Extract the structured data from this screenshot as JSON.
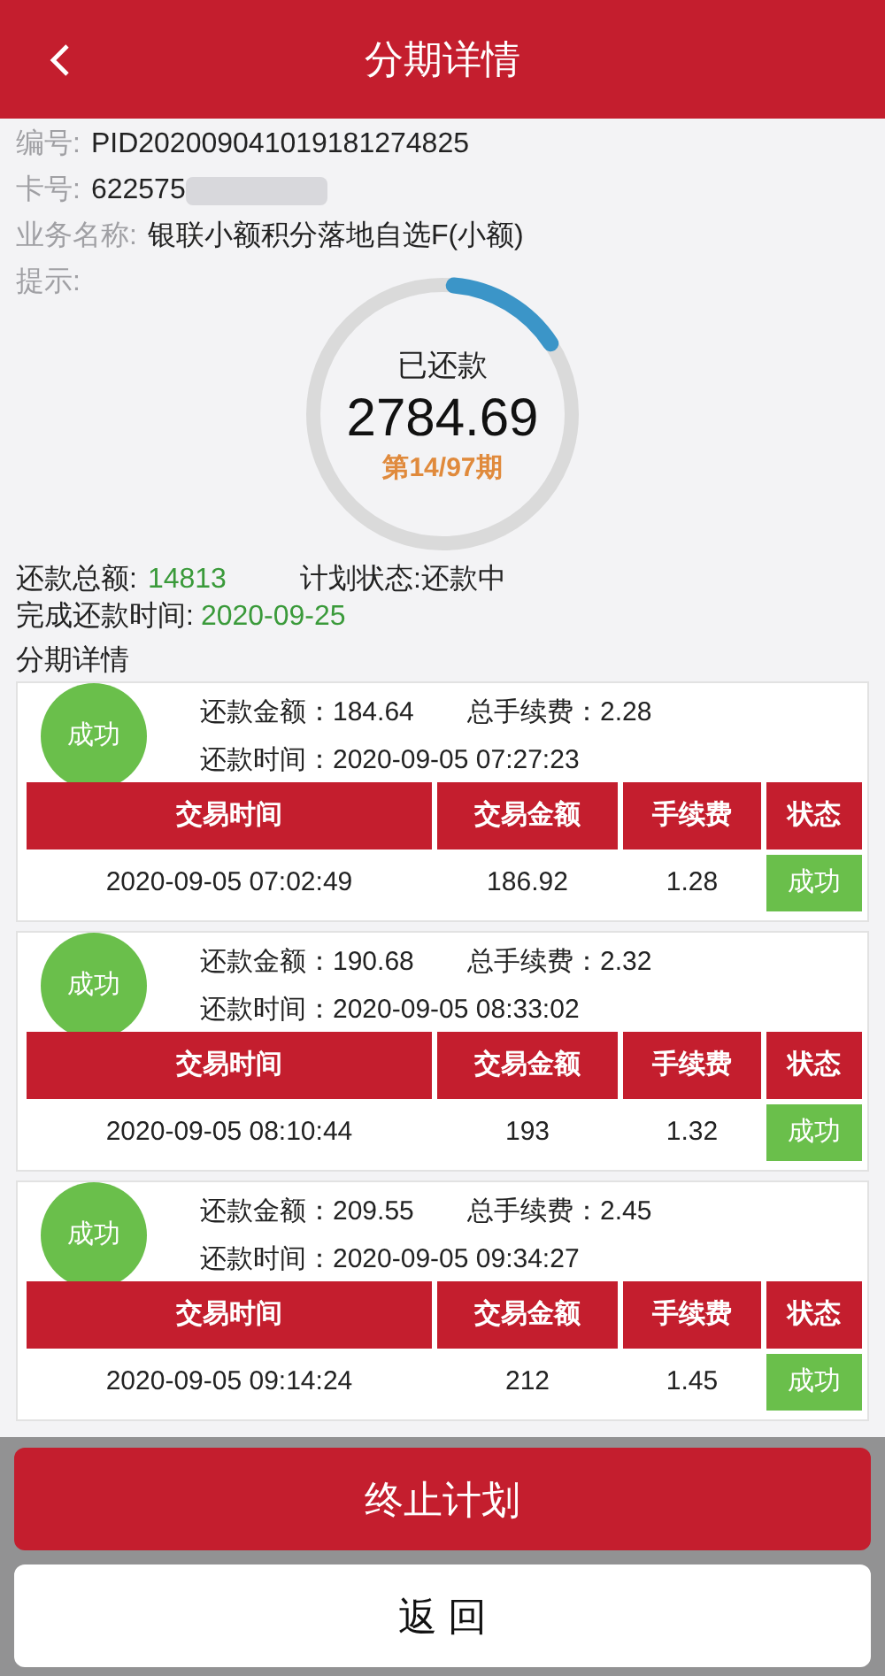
{
  "header": {
    "title": "分期详情"
  },
  "info": [
    {
      "label": "编号:",
      "value": "PID202009041019181274825"
    },
    {
      "label": "卡号:",
      "value": "622575",
      "redacted": true
    },
    {
      "label": "业务名称:",
      "value": "银联小额积分落地自选F(小额)"
    },
    {
      "label": "提示:"
    }
  ],
  "progress": {
    "caption": "已还款",
    "amount": "2784.69",
    "period": "第14/97期",
    "level": 0.144
  },
  "summary": {
    "total_label": "还款总额:",
    "total": "14813",
    "status": "计划状态:还款中",
    "finish_label": "完成还款时间:",
    "finish": "2020-09-25"
  },
  "section_title": "分期详情",
  "installments": [
    {
      "columns": [
        "交易时间",
        "交易金额",
        "手续费",
        "状态"
      ],
      "badge": "成功",
      "amount_label": "还款金额：",
      "amount": "184.64",
      "fee_label": "总手续费：",
      "fee": "2.28",
      "time_label": "还款时间：",
      "time": "2020-09-05 07:27:23",
      "row": [
        "2020-09-05 07:02:49",
        "186.92",
        "1.28",
        "成功"
      ]
    },
    {
      "columns": [
        "交易时间",
        "交易金额",
        "手续费",
        "状态"
      ],
      "badge": "成功",
      "amount_label": "还款金额：",
      "amount": "190.68",
      "fee_label": "总手续费：",
      "fee": "2.32",
      "time_label": "还款时间：",
      "time": "2020-09-05 08:33:02",
      "row": [
        "2020-09-05 08:10:44",
        "193",
        "1.32",
        "成功"
      ]
    },
    {
      "columns": [
        "交易时间",
        "交易金额",
        "手续费",
        "状态"
      ],
      "badge": "成功",
      "amount_label": "还款金额：",
      "amount": "209.55",
      "fee_label": "总手续费：",
      "fee": "2.45",
      "time_label": "还款时间：",
      "time": "2020-09-05 09:34:27",
      "row": [
        "2020-09-05 09:14:24",
        "212",
        "1.45",
        "成功"
      ]
    }
  ],
  "actions": [
    "终止计划",
    "返 回"
  ]
}
